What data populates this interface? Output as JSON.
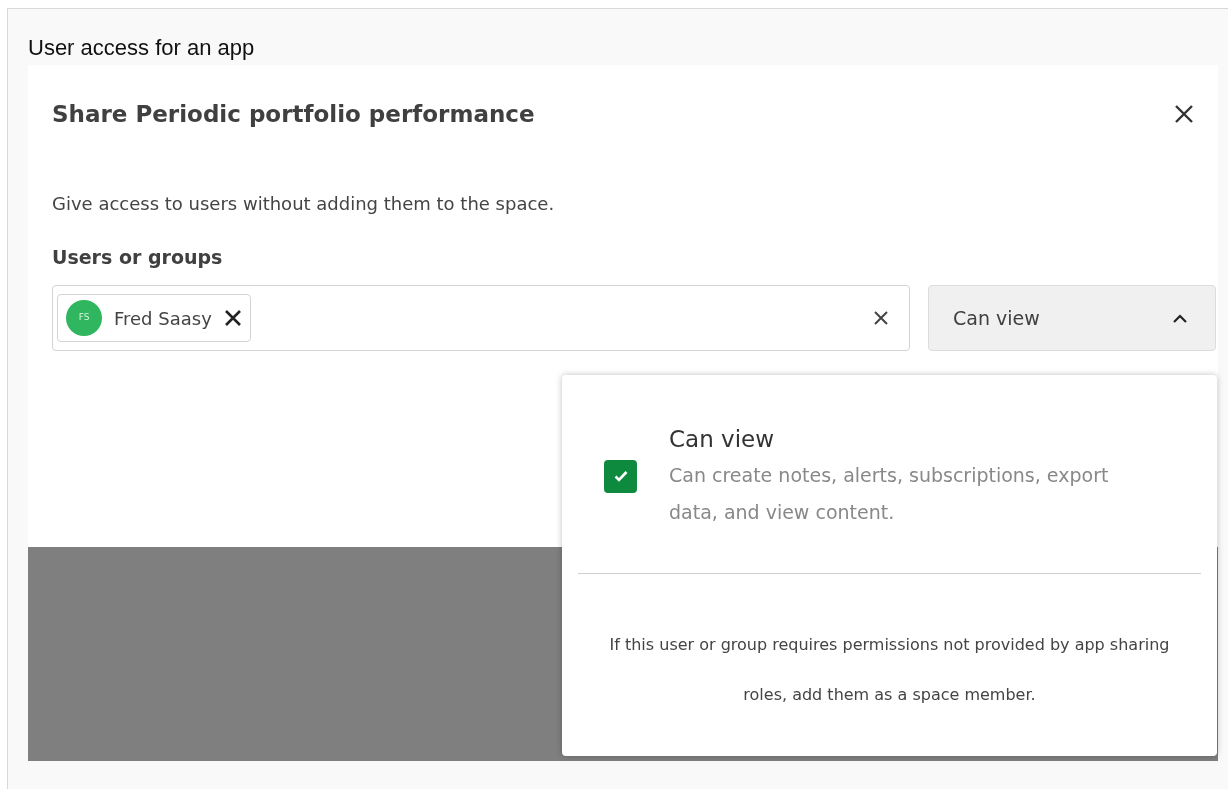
{
  "caption": "User access for an app",
  "dialog": {
    "title": "Share Periodic portfolio performance",
    "description": "Give access to users without adding them to the space.",
    "users_label": "Users or groups",
    "chips": [
      {
        "initials": "FS",
        "name": "Fred Saasy",
        "color": "#2fb65f"
      }
    ],
    "role_select": {
      "value": "Can view",
      "expanded": true
    },
    "menu": {
      "options": [
        {
          "title": "Can view",
          "description": "Can create notes, alerts, subscriptions, export data, and view content.",
          "checked": true
        }
      ],
      "note": "If this user or group requires permissions not provided by app sharing roles, add them as a space member."
    }
  }
}
